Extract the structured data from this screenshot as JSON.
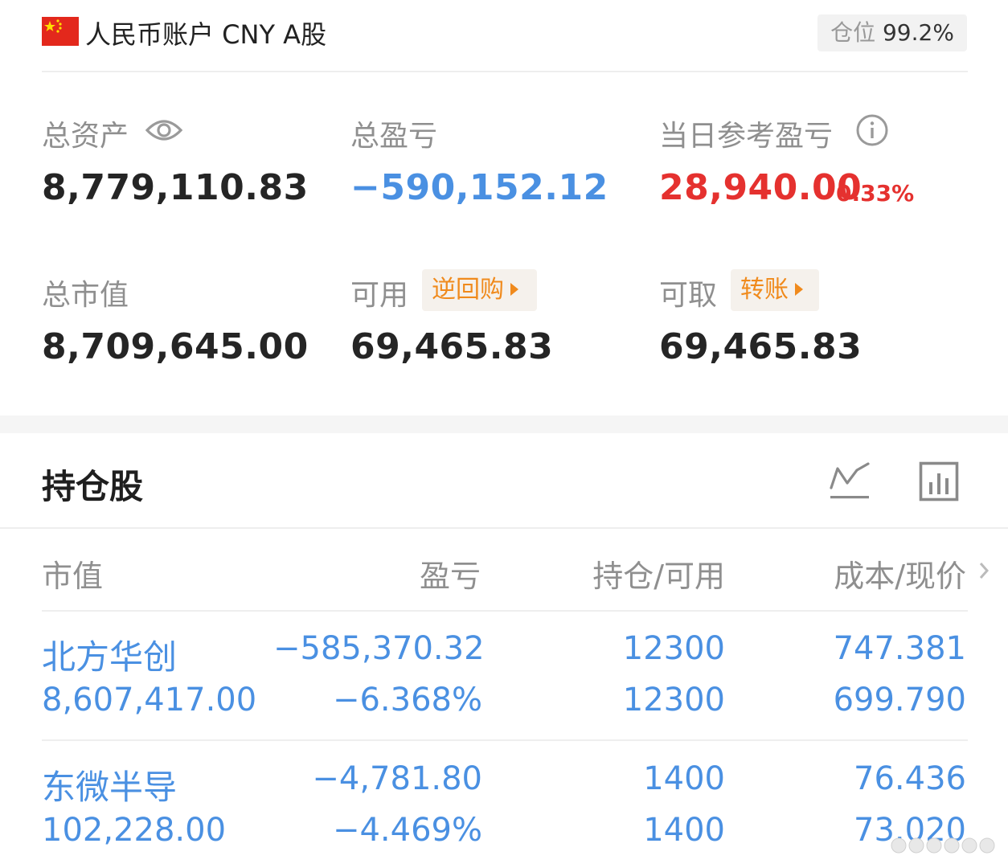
{
  "header": {
    "account_title": "人民币账户 CNY A股",
    "position_label": "仓位",
    "position_value": "99.2%"
  },
  "summary": {
    "total_assets_label": "总资产",
    "total_assets_value": "8,779,110.83",
    "total_pnl_label": "总盈亏",
    "total_pnl_value": "−590,152.12",
    "daily_pnl_label": "当日参考盈亏",
    "daily_pnl_value": "28,940.00",
    "daily_pnl_pct": "0.33%",
    "market_value_label": "总市值",
    "market_value_value": "8,709,645.00",
    "available_label": "可用",
    "available_value": "69,465.83",
    "repo_button": "逆回购",
    "withdrawable_label": "可取",
    "withdrawable_value": "69,465.83",
    "transfer_button": "转账"
  },
  "holdings": {
    "title": "持仓股",
    "columns": [
      "市值",
      "盈亏",
      "持仓/可用",
      "成本/现价"
    ],
    "rows": [
      {
        "name": "北方华创",
        "market_value": "8,607,417.00",
        "pnl": "−585,370.32",
        "pnl_pct": "−6.368%",
        "position": "12300",
        "available": "12300",
        "cost": "747.381",
        "price": "699.790"
      },
      {
        "name": "东微半导",
        "market_value": "102,228.00",
        "pnl": "−4,781.80",
        "pnl_pct": "−4.469%",
        "position": "1400",
        "available": "1400",
        "cost": "76.436",
        "price": "73.020"
      }
    ]
  },
  "colors": {
    "blue": "#4a90e2",
    "red": "#e5312f",
    "orange": "#f08a1c",
    "flag_red": "#e3281c"
  },
  "icons": [
    "china-flag-icon",
    "eye-icon",
    "info-icon",
    "trend-line-icon",
    "bar-chart-icon",
    "chevron-right-icon"
  ]
}
